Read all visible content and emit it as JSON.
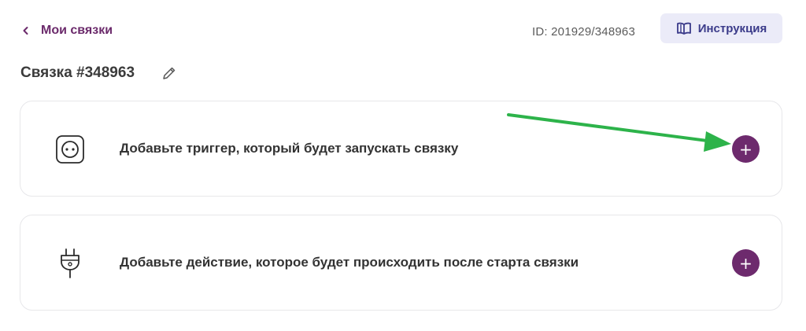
{
  "header": {
    "back_label": "Мои связки",
    "connection_id": "ID: 201929/348963",
    "instruction_label": "Инструкция"
  },
  "title": {
    "text": "Связка #348963"
  },
  "cards": {
    "trigger": {
      "text": "Добавьте триггер, который будет запускать связку",
      "icon": "socket-icon",
      "add_symbol": "+"
    },
    "action": {
      "text": "Добавьте действие, которое будет происходить после старта связки",
      "icon": "plug-icon",
      "add_symbol": "+"
    }
  },
  "colors": {
    "accent": "#6d2a6d",
    "instruction_bg": "#ebebf8",
    "instruction_text": "#3b3b8a",
    "annotation_arrow": "#2db34a"
  }
}
